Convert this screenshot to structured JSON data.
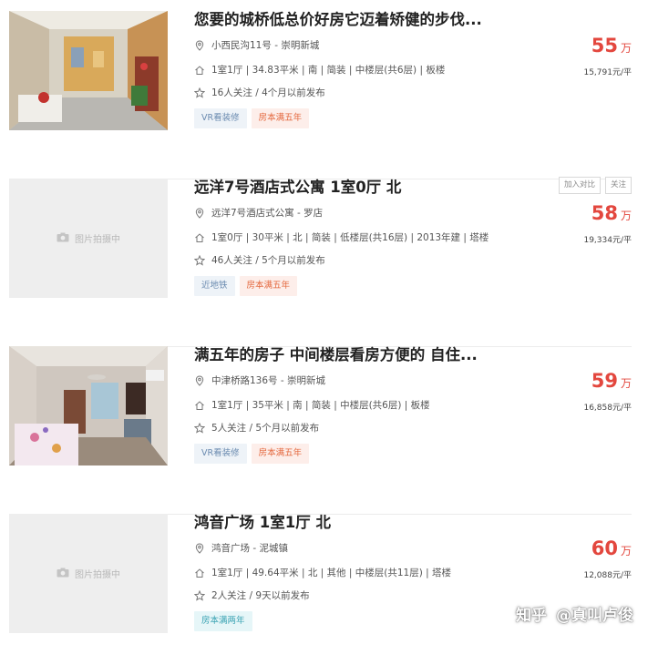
{
  "listings": [
    {
      "title": "您要的城桥低总价好房它迈着矫健的步伐...",
      "position": "小西民沟11号 - 崇明新城",
      "house_info": "1室1厅 | 34.83平米 | 南 | 简装 | 中楼层(共6层) | 板楼",
      "follow_info": "16人关注 / 4个月以前发布",
      "tags": [
        {
          "label": "VR看装修",
          "style": "vr"
        },
        {
          "label": "房本满五年",
          "style": "five"
        }
      ],
      "price": "55",
      "price_unit": "万",
      "unit_price": "15,791元/平",
      "photo": "room-photo",
      "actions": []
    },
    {
      "title": "远洋7号酒店式公寓 1室0厅 北",
      "position": "远洋7号酒店式公寓 - 罗店",
      "house_info": "1室0厅 | 30平米 | 北 | 简装 | 低楼层(共16层) | 2013年建 | 塔楼",
      "follow_info": "46人关注 / 5个月以前发布",
      "tags": [
        {
          "label": "近地铁",
          "style": "subway"
        },
        {
          "label": "房本满五年",
          "style": "five"
        }
      ],
      "price": "58",
      "price_unit": "万",
      "unit_price": "19,334元/平",
      "photo": "placeholder",
      "placeholder_text": "图片拍摄中",
      "actions": [
        "加入对比",
        "关注"
      ]
    },
    {
      "title": "满五年的房子 中间楼层看房方便的 自住...",
      "position": "中津桥路136号 - 崇明新城",
      "house_info": "1室1厅 | 35平米 | 南 | 简装 | 中楼层(共6层) | 板楼",
      "follow_info": "5人关注 / 5个月以前发布",
      "tags": [
        {
          "label": "VR看装修",
          "style": "vr"
        },
        {
          "label": "房本满五年",
          "style": "five"
        }
      ],
      "price": "59",
      "price_unit": "万",
      "unit_price": "16,858元/平",
      "photo": "room-photo-2",
      "actions": []
    },
    {
      "title": "鸿音广场 1室1厅 北",
      "position": "鸿音广场 - 泥城镇",
      "house_info": "1室1厅 | 49.64平米 | 北 | 其他 | 中楼层(共11层) | 塔楼",
      "follow_info": "2人关注 / 9天以前发布",
      "tags": [
        {
          "label": "房本满两年",
          "style": "two"
        }
      ],
      "price": "60",
      "price_unit": "万",
      "unit_price": "12,088元/平",
      "photo": "placeholder",
      "placeholder_text": "图片拍摄中",
      "actions": []
    }
  ],
  "watermark": {
    "site": "知乎",
    "author": "@真叫卢俊"
  },
  "colors": {
    "price": "#e3473e",
    "tag_five_bg": "#fdeeea",
    "tag_vr_bg": "#eef3f8",
    "tag_two_bg": "#e6f6f8"
  }
}
